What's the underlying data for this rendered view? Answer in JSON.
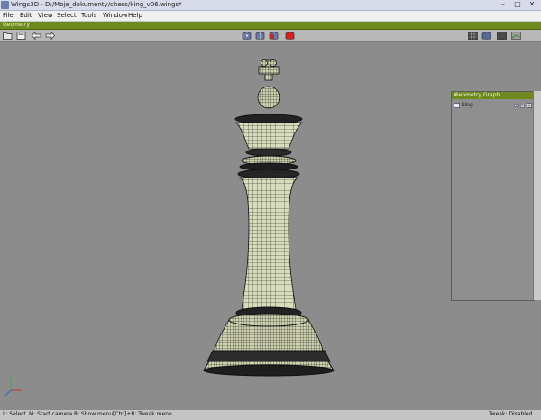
{
  "window": {
    "title": "Wings3D - D:/Moje_dokumenty/chess/king_v06.wings*",
    "controls": {
      "minimize": "–",
      "maximize": "□",
      "close": "✕"
    }
  },
  "menubar": {
    "items": [
      "File",
      "Edit",
      "View",
      "Select",
      "Tools",
      "Window",
      "Help"
    ]
  },
  "geometry_bar": {
    "label": "Geometry"
  },
  "toolbar": {
    "left_icons": [
      "open-folder-icon",
      "save-icon",
      "undo-arrow-icon",
      "redo-arrow-icon"
    ],
    "select_mode_icons": [
      "vertex-mode-icon",
      "edge-mode-icon",
      "face-mode-icon",
      "body-mode-icon"
    ],
    "right_icons": [
      "groundplane-icon",
      "axes-icon",
      "smooth-shade-icon",
      "perspective-icon"
    ],
    "accent": "#cc2222"
  },
  "geometry_graph": {
    "title": "Geometry Graph",
    "close": "x",
    "objects": [
      {
        "name": "king"
      }
    ]
  },
  "status": {
    "l_select": "L: Select",
    "m_camera": "M: Start camera",
    "r_menu": "R: Show menu",
    "tweak_menu": "[Ctrl]+R: Tweak menu",
    "tweak_state": "Tweak: Disabled"
  },
  "colors": {
    "geometry_bar": "#6e8a1e",
    "viewport_bg": "#8c8c8c",
    "mesh_fill": "#d8dbb8",
    "mesh_wire": "#1a1a1a"
  }
}
